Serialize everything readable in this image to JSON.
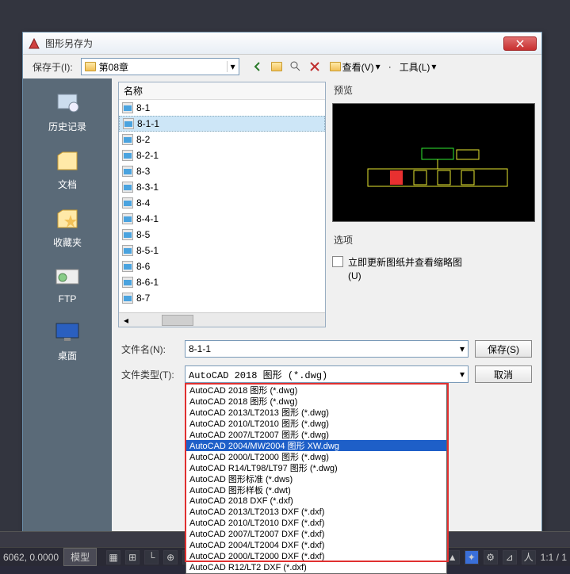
{
  "dialog": {
    "title": "图形另存为",
    "save_in_label": "保存于(I):",
    "save_in_value": "第08章",
    "view_label": "查看(V)",
    "tools_label": "工具(L)",
    "name_header": "名称",
    "preview_label": "预览",
    "options_label": "选项",
    "update_thumb_label": "立即更新图纸并查看缩略图(U)",
    "filename_label": "文件名(N):",
    "filename_value": "8-1-1",
    "filetype_label": "文件类型(T):",
    "filetype_value": "AutoCAD 2018 图形 (*.dwg)",
    "save_btn": "保存(S)",
    "cancel_btn": "取消"
  },
  "sidebar": {
    "items": [
      {
        "label": "历史记录",
        "icon": "history"
      },
      {
        "label": "文档",
        "icon": "documents"
      },
      {
        "label": "收藏夹",
        "icon": "favorites"
      },
      {
        "label": "FTP",
        "icon": "ftp"
      },
      {
        "label": "桌面",
        "icon": "desktop"
      }
    ]
  },
  "files": [
    {
      "name": "8-1"
    },
    {
      "name": "8-1-1",
      "selected": true
    },
    {
      "name": "8-2"
    },
    {
      "name": "8-2-1"
    },
    {
      "name": "8-3"
    },
    {
      "name": "8-3-1"
    },
    {
      "name": "8-4"
    },
    {
      "name": "8-4-1"
    },
    {
      "name": "8-5"
    },
    {
      "name": "8-5-1"
    },
    {
      "name": "8-6"
    },
    {
      "name": "8-6-1"
    },
    {
      "name": "8-7"
    }
  ],
  "filetypes": [
    {
      "label": "AutoCAD 2018 图形 (*.dwg)"
    },
    {
      "label": "AutoCAD 2018 图形 (*.dwg)"
    },
    {
      "label": "AutoCAD 2013/LT2013 图形 (*.dwg)"
    },
    {
      "label": "AutoCAD 2010/LT2010 图形 (*.dwg)"
    },
    {
      "label": "AutoCAD 2007/LT2007 图形 (*.dwg)"
    },
    {
      "label": "AutoCAD 2004/MW2004 图形 XW.dwg",
      "hl": true
    },
    {
      "label": "AutoCAD 2000/LT2000 图形 (*.dwg)"
    },
    {
      "label": "AutoCAD R14/LT98/LT97 图形 (*.dwg)"
    },
    {
      "label": "AutoCAD 图形标准 (*.dws)"
    },
    {
      "label": "AutoCAD 图形样板 (*.dwt)"
    },
    {
      "label": "AutoCAD 2018 DXF (*.dxf)"
    },
    {
      "label": "AutoCAD 2013/LT2013 DXF (*.dxf)"
    },
    {
      "label": "AutoCAD 2010/LT2010 DXF (*.dxf)"
    },
    {
      "label": "AutoCAD 2007/LT2007 DXF (*.dxf)"
    },
    {
      "label": "AutoCAD 2004/LT2004 DXF (*.dxf)"
    },
    {
      "label": "AutoCAD 2000/LT2000 DXF (*.dxf)"
    },
    {
      "label": "AutoCAD R12/LT2 DXF (*.dxf)"
    }
  ],
  "statusbar": {
    "coords": "6062, 0.0000",
    "model": "模型",
    "ratio": "1:1 / 1"
  }
}
